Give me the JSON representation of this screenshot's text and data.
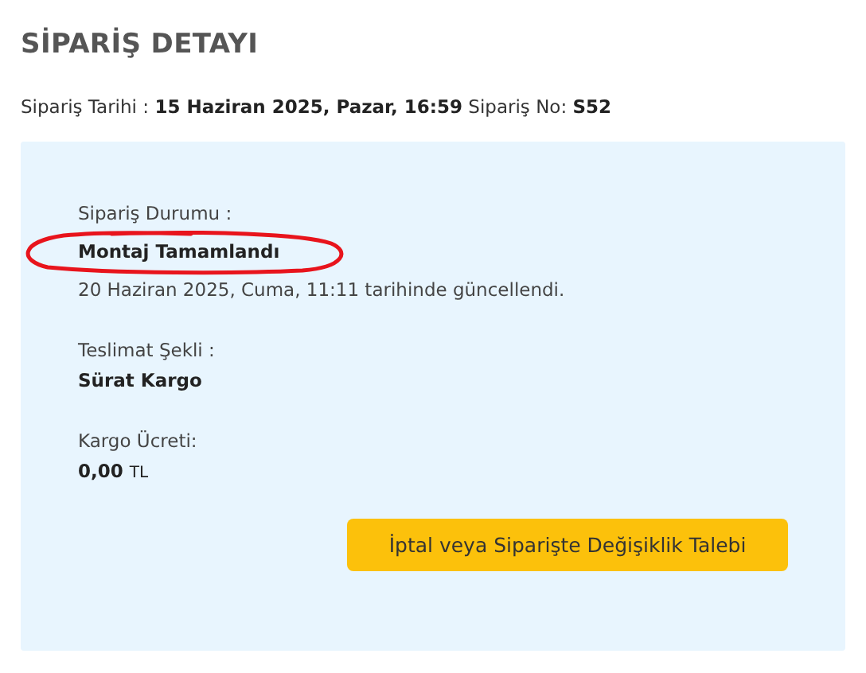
{
  "title": "SİPARİŞ DETAYI",
  "order_info": {
    "date_label": "Sipariş Tarihi :",
    "date_value": "15 Haziran 2025, Pazar, 16:59",
    "number_label": "Sipariş No:",
    "number_value": "S52"
  },
  "details": [
    {
      "label": "Sipariş Durumu :",
      "value": "Montaj Tamamlandı",
      "note": "20 Haziran 2025, Cuma, 11:11 tarihinde güncellendi."
    },
    {
      "label": "Teslimat Şekli :",
      "value": "Sürat Kargo"
    },
    {
      "label": "Kargo Ücreti:",
      "value": "0,00",
      "unit": "TL"
    }
  ],
  "button": "İptal veya Siparişte Değişiklik Talebi"
}
